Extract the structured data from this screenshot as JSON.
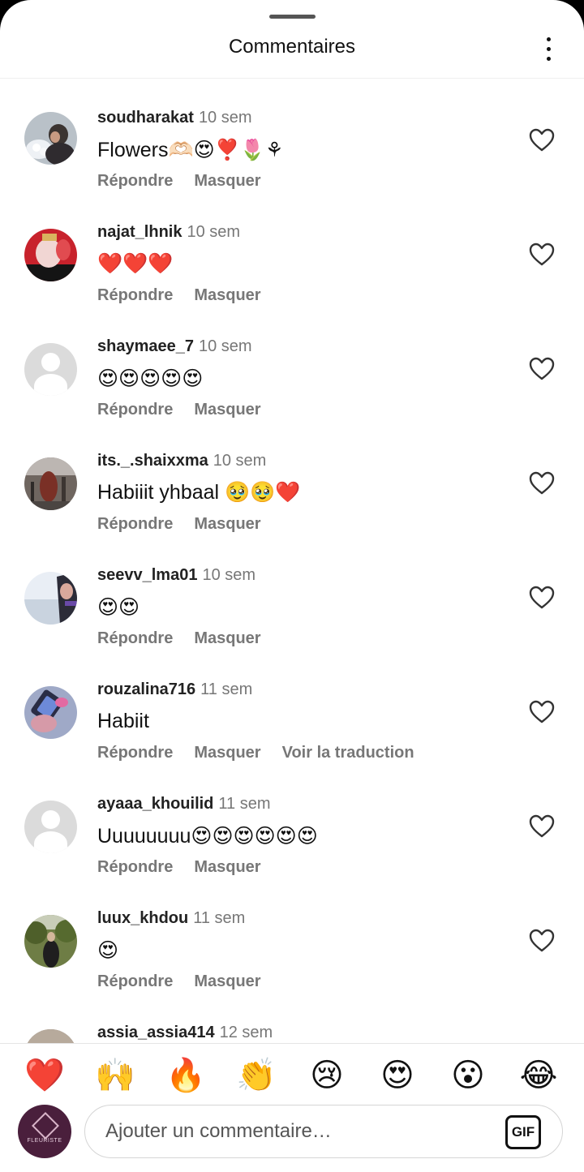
{
  "header": {
    "title": "Commentaires",
    "more_icon": "more-vertical-icon"
  },
  "actions_labels": {
    "reply": "Répondre",
    "hide": "Masquer",
    "translate": "Voir la traduction"
  },
  "comments": [
    {
      "username": "soudharakat",
      "time": "10 sem",
      "text": "Flowers🫶🏻😍❣️🌷⚘",
      "avatar": "photo"
    },
    {
      "username": "najat_lhnik",
      "time": "10 sem",
      "text": "❤️❤️❤️",
      "avatar": "photo"
    },
    {
      "username": "shaymaee_7",
      "time": "10 sem",
      "text": "😍😍😍😍😍",
      "avatar": "default"
    },
    {
      "username": "its._.shaixxma",
      "time": "10 sem",
      "text": "Habiiit yhbaal 🥹🥹❤️",
      "avatar": "photo"
    },
    {
      "username": "seevv_lma01",
      "time": "10 sem",
      "text": "😍😍",
      "avatar": "photo"
    },
    {
      "username": "rouzalina716",
      "time": "11 sem",
      "text": "Habiit",
      "avatar": "photo",
      "translate": true
    },
    {
      "username": "ayaaa_khouilid",
      "time": "11 sem",
      "text": "Uuuuuuuu😍😍😍😍😍😍",
      "avatar": "default"
    },
    {
      "username": "luux_khdou",
      "time": "11 sem",
      "text": "😍",
      "avatar": "photo"
    },
    {
      "username": "assia_assia414",
      "time": "12 sem",
      "text": "",
      "avatar": "photo"
    }
  ],
  "reactions": [
    "❤️",
    "🙌",
    "🔥",
    "👏",
    "😢",
    "😍",
    "😮",
    "😂"
  ],
  "composer": {
    "placeholder": "Ajouter un commentaire…",
    "gif_label": "GIF",
    "avatar_label": "FLEURISTE"
  }
}
